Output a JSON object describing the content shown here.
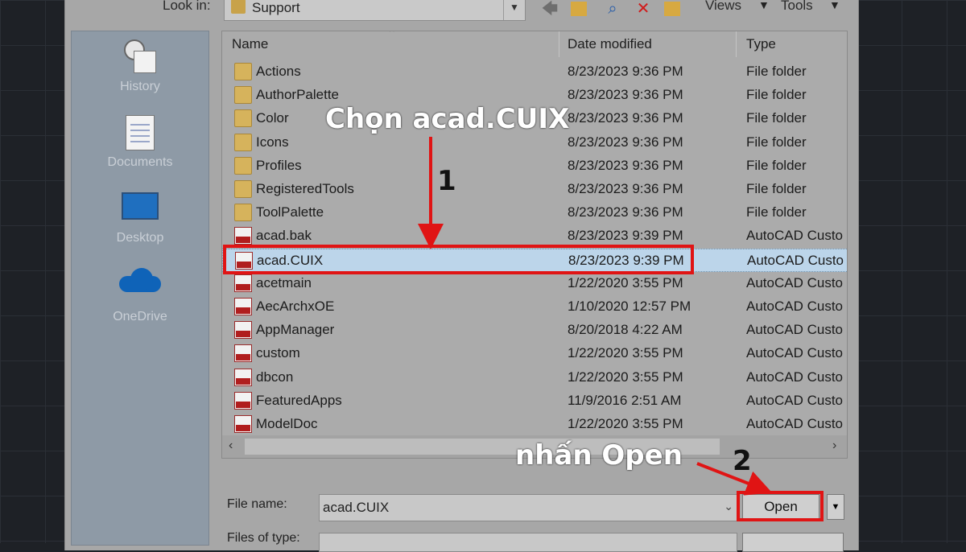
{
  "toolbar": {
    "look_in_label": "Look in:",
    "look_in_value": "Support",
    "views_label": "Views",
    "tools_label": "Tools"
  },
  "places": [
    {
      "label": "History",
      "icon": "history-icon"
    },
    {
      "label": "Documents",
      "icon": "documents-icon"
    },
    {
      "label": "Desktop",
      "icon": "desktop-icon"
    },
    {
      "label": "OneDrive",
      "icon": "onedrive-icon"
    }
  ],
  "filelist": {
    "columns": [
      "Name",
      "Date modified",
      "Type"
    ],
    "rows": [
      {
        "name": "Actions",
        "date": "8/23/2023 9:36 PM",
        "type": "File folder",
        "kind": "folder"
      },
      {
        "name": "AuthorPalette",
        "date": "8/23/2023 9:36 PM",
        "type": "File folder",
        "kind": "folder"
      },
      {
        "name": "Color",
        "date": "8/23/2023 9:36 PM",
        "type": "File folder",
        "kind": "folder"
      },
      {
        "name": "Icons",
        "date": "8/23/2023 9:36 PM",
        "type": "File folder",
        "kind": "folder"
      },
      {
        "name": "Profiles",
        "date": "8/23/2023 9:36 PM",
        "type": "File folder",
        "kind": "folder"
      },
      {
        "name": "RegisteredTools",
        "date": "8/23/2023 9:36 PM",
        "type": "File folder",
        "kind": "folder"
      },
      {
        "name": "ToolPalette",
        "date": "8/23/2023 9:36 PM",
        "type": "File folder",
        "kind": "folder"
      },
      {
        "name": "acad.bak",
        "date": "8/23/2023 9:39 PM",
        "type": "AutoCAD Custo",
        "kind": "cuix"
      },
      {
        "name": "acad.CUIX",
        "date": "8/23/2023 9:39 PM",
        "type": "AutoCAD Custo",
        "kind": "cuix",
        "selected": true
      },
      {
        "name": "acetmain",
        "date": "1/22/2020 3:55 PM",
        "type": "AutoCAD Custo",
        "kind": "cuix"
      },
      {
        "name": "AecArchxOE",
        "date": "1/10/2020 12:57 PM",
        "type": "AutoCAD Custo",
        "kind": "cuix"
      },
      {
        "name": "AppManager",
        "date": "8/20/2018 4:22 AM",
        "type": "AutoCAD Custo",
        "kind": "cuix"
      },
      {
        "name": "custom",
        "date": "1/22/2020 3:55 PM",
        "type": "AutoCAD Custo",
        "kind": "cuix"
      },
      {
        "name": "dbcon",
        "date": "1/22/2020 3:55 PM",
        "type": "AutoCAD Custo",
        "kind": "cuix"
      },
      {
        "name": "FeaturedApps",
        "date": "11/9/2016 2:51 AM",
        "type": "AutoCAD Custo",
        "kind": "cuix"
      },
      {
        "name": "ModelDoc",
        "date": "1/22/2020 3:55 PM",
        "type": "AutoCAD Custo",
        "kind": "cuix"
      }
    ]
  },
  "form": {
    "file_name_label": "File name:",
    "file_name_value": "acad.CUIX",
    "open_button": "Open",
    "files_of_type_label": "Files of type:"
  },
  "annotations": {
    "step1_text": "Chọn acad.CUIX",
    "step1_number": "1",
    "step2_text": "nhấn Open",
    "step2_number": "2",
    "color": "#e01414"
  }
}
